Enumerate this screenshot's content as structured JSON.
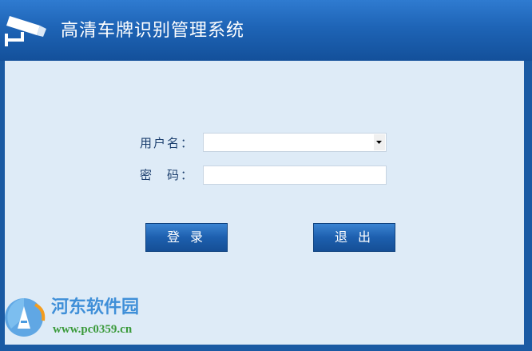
{
  "window": {
    "title": "高清车牌识别管理系统"
  },
  "login_form": {
    "username_label": "用户名：",
    "username_value": "",
    "password_label": "密　码：",
    "password_value": "",
    "login_button": "登 录",
    "exit_button": "退 出"
  },
  "watermark": {
    "site_name": "河东软件园",
    "url": "www.pc0359.cn"
  },
  "colors": {
    "titlebar": "#1e64b6",
    "content_bg": "#deebf7",
    "button": "#1d5fae",
    "label_text": "#1c3f6e"
  },
  "icons": {
    "title": "camera-icon",
    "dropdown": "dropdown-arrow-icon",
    "watermark": "pc0359-logo-icon"
  }
}
